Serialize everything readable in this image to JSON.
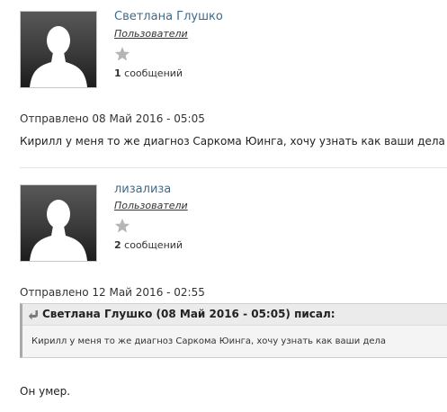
{
  "posts": [
    {
      "author": "Светлана Глушко",
      "group": "Пользователи",
      "message_count": "1",
      "message_count_label": "сообщений",
      "posted": "Отправлено 08 Май 2016 - 05:05",
      "text": "Кирилл у меня то же диагноз Саркома Юинга, хочу узнать как ваши дела"
    },
    {
      "author": "лизализа",
      "group": "Пользователи",
      "message_count": "2",
      "message_count_label": "сообщений",
      "posted": "Отправлено 12 Май 2016 - 02:55",
      "quote": {
        "cite": "Светлана Глушко (08 Май 2016 - 05:05) писал:",
        "text": "Кирилл у меня то же диагноз Саркома Юинга, хочу узнать как ваши дела"
      },
      "text": "Он умер."
    }
  ],
  "icons": {
    "avatar": "default-avatar-icon",
    "rank": "rank-star-icon",
    "quote": "quote-arrow-icon"
  },
  "colors": {
    "username_link": "#3d6b8e",
    "star": "#b5b5b5",
    "quote_background": "#f4f4f4"
  }
}
